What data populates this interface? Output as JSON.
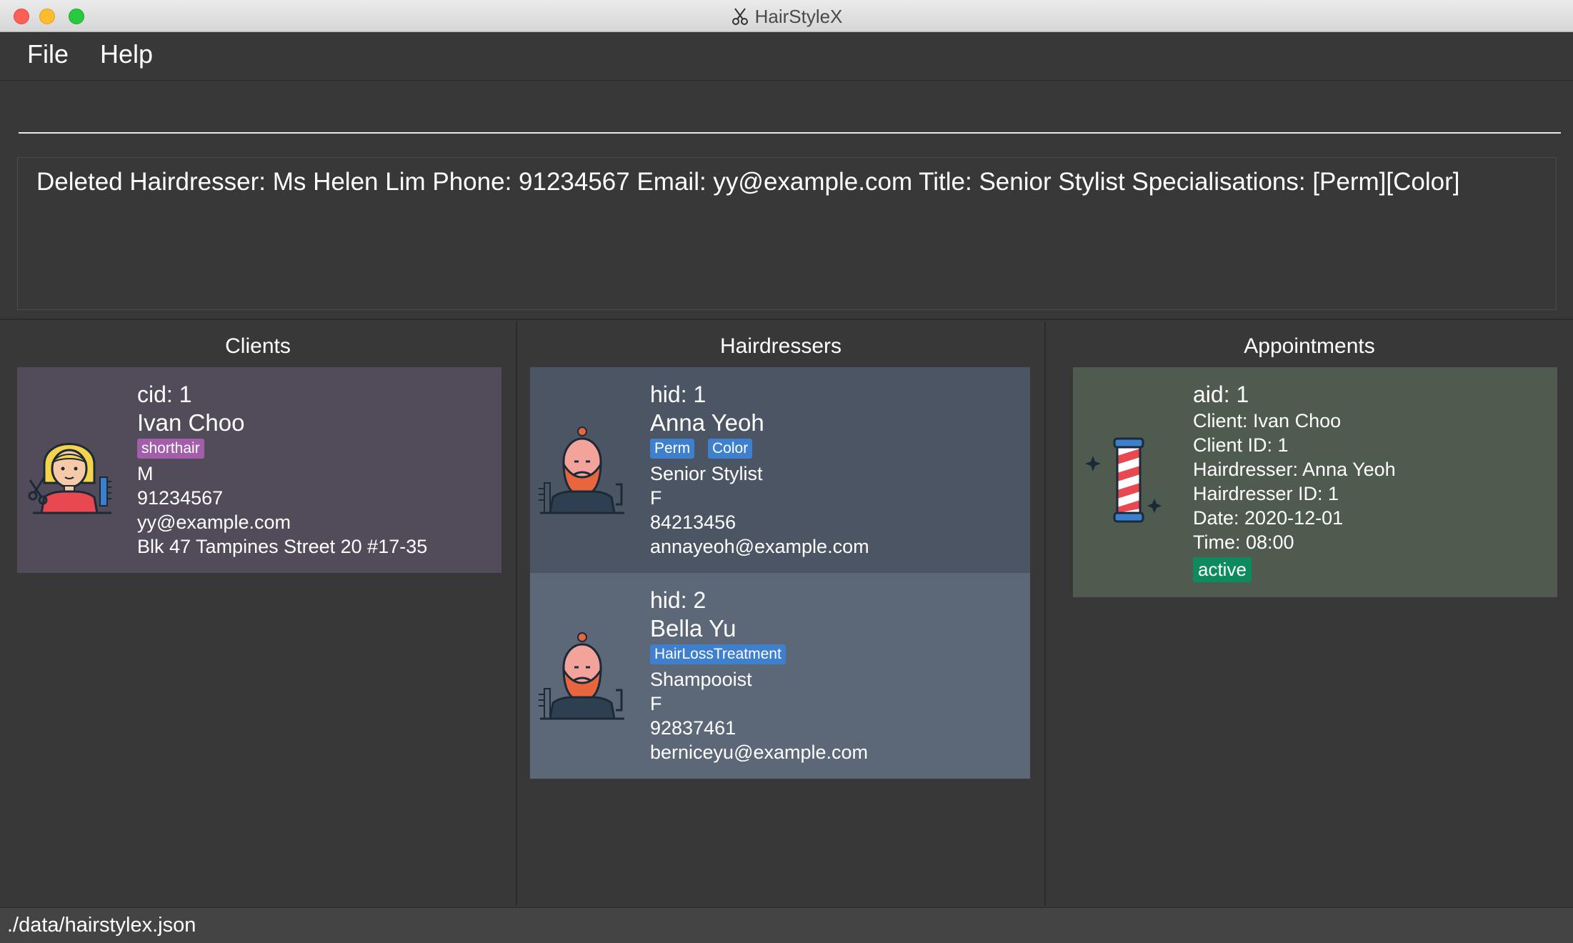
{
  "window": {
    "title": "HairStyleX"
  },
  "menu": {
    "file": "File",
    "help": "Help"
  },
  "command": {
    "value": "",
    "placeholder": ""
  },
  "result": {
    "text": "Deleted Hairdresser: Ms Helen Lim Phone: 91234567 Email: yy@example.com Title: Senior Stylist Specialisations: [Perm][Color]"
  },
  "clients": {
    "header": "Clients",
    "items": [
      {
        "id": "cid: 1",
        "name": "Ivan Choo",
        "tags": [
          "shorthair"
        ],
        "gender": "M",
        "phone": "91234567",
        "email": "yy@example.com",
        "address": "Blk 47 Tampines Street 20 #17-35",
        "avatar_icon": "female-hairdresser-icon"
      }
    ]
  },
  "hairdressers": {
    "header": "Hairdressers",
    "items": [
      {
        "id": "hid: 1",
        "name": "Anna Yeoh",
        "tags": [
          "Perm",
          "Color"
        ],
        "title": "Senior Stylist",
        "gender": "F",
        "phone": "84213456",
        "email": "annayeoh@example.com",
        "avatar_icon": "bearded-barber-icon"
      },
      {
        "id": "hid: 2",
        "name": "Bella Yu",
        "tags": [
          "HairLossTreatment"
        ],
        "title": "Shampooist",
        "gender": "F",
        "phone": "92837461",
        "email": "berniceyu@example.com",
        "avatar_icon": "bearded-barber-icon"
      }
    ]
  },
  "appointments": {
    "header": "Appointments",
    "items": [
      {
        "id": "aid: 1",
        "client": "Client: Ivan Choo",
        "client_id": "Client ID: 1",
        "hairdresser": "Hairdresser: Anna Yeoh",
        "hairdresser_id": "Hairdresser ID: 1",
        "date": "Date: 2020-12-01",
        "time": "Time: 08:00",
        "status": "active",
        "avatar_icon": "barber-pole-icon"
      }
    ]
  },
  "status_bar": {
    "path": "./data/hairstylex.json"
  },
  "colors": {
    "client_card": "#524b5a",
    "hairdresser_card_1": "#4b5563",
    "hairdresser_card_2": "#5c6877",
    "appointment_card": "#4e5b4e",
    "tag_purple": "#a25ea8",
    "tag_blue": "#3e7fce",
    "status_active": "#0e8a5f"
  }
}
